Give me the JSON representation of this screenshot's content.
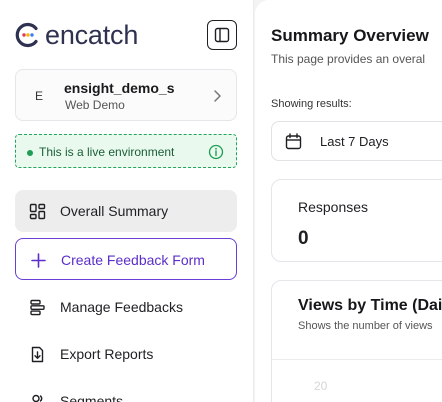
{
  "brand": {
    "name": "encatch"
  },
  "workspace": {
    "avatar": "E",
    "name": "ensight_demo_s",
    "subtitle": "Web Demo"
  },
  "env": {
    "label": "This is a live environment"
  },
  "nav": {
    "items": [
      {
        "label": "Overall Summary"
      },
      {
        "label": "Create Feedback Form"
      },
      {
        "label": "Manage Feedbacks"
      },
      {
        "label": "Export Reports"
      },
      {
        "label": "Segments"
      }
    ]
  },
  "main": {
    "title": "Summary Overview",
    "subtitle": "This page provides an overal",
    "showing_label": "Showing results:",
    "date_range": "Last 7 Days",
    "responses": {
      "label": "Responses",
      "value": "0"
    },
    "views": {
      "title": "Views by Time (Daily",
      "subtitle": "Shows the number of views",
      "axis_hint": "20"
    }
  },
  "colors": {
    "accent": "#5b2ec9",
    "live_green": "#22a55b",
    "brand_text": "#2e3150"
  }
}
